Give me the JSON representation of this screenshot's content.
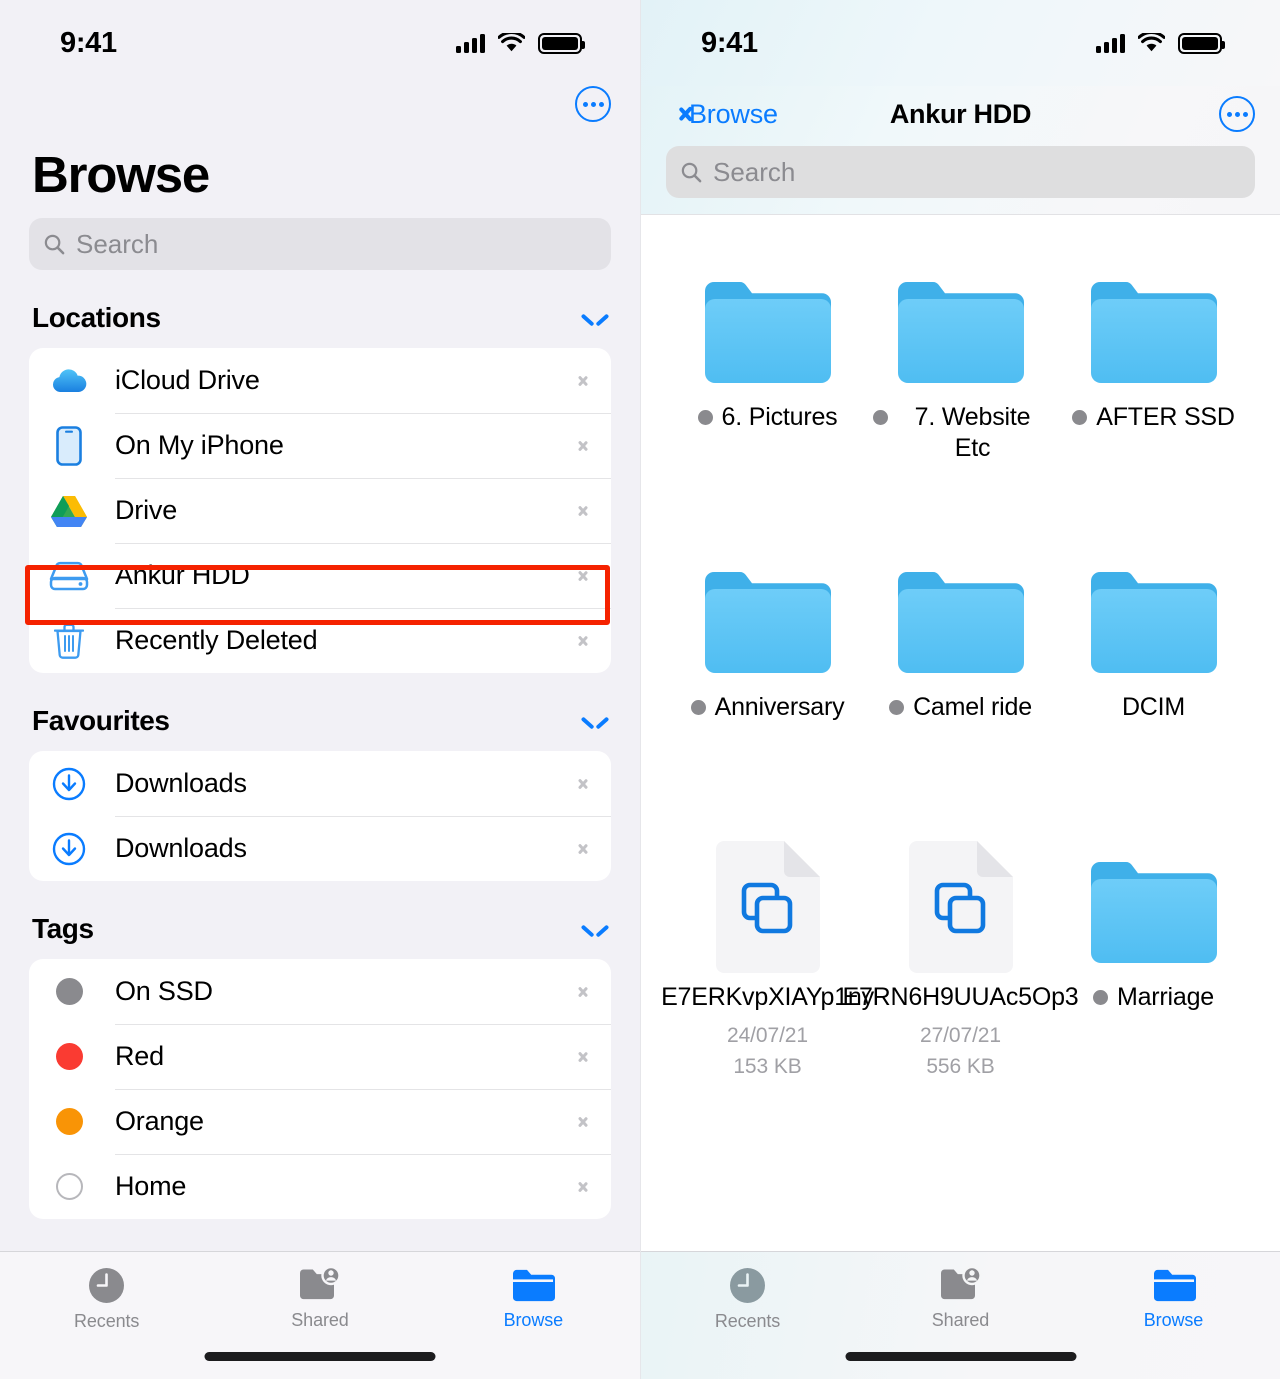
{
  "statusbar": {
    "time": "9:41"
  },
  "left": {
    "title": "Browse",
    "search_placeholder": "Search",
    "more_button": "more-options",
    "sections": [
      {
        "title": "Locations",
        "items": [
          {
            "label": "iCloud Drive",
            "icon": "icloud-drive-icon"
          },
          {
            "label": "On My iPhone",
            "icon": "iphone-icon"
          },
          {
            "label": "Drive",
            "icon": "google-drive-icon"
          },
          {
            "label": "Ankur HDD",
            "icon": "external-drive-icon",
            "highlighted": true
          },
          {
            "label": "Recently Deleted",
            "icon": "trash-icon"
          }
        ]
      },
      {
        "title": "Favourites",
        "items": [
          {
            "label": "Downloads",
            "icon": "download-circle-icon"
          },
          {
            "label": "Downloads",
            "icon": "download-circle-icon"
          }
        ]
      },
      {
        "title": "Tags",
        "items": [
          {
            "label": "On SSD",
            "icon": "tag-dot-icon",
            "color": "#8a8a8e"
          },
          {
            "label": "Red",
            "icon": "tag-dot-icon",
            "color": "#fa3b32"
          },
          {
            "label": "Orange",
            "icon": "tag-dot-icon",
            "color": "#f99406"
          },
          {
            "label": "Home",
            "icon": "tag-dot-icon",
            "color": "#ffffff"
          }
        ]
      }
    ]
  },
  "right": {
    "back_label": "Browse",
    "title": "Ankur HDD",
    "search_placeholder": "Search",
    "more_button": "more-options",
    "items": [
      {
        "name": "6. Pictures",
        "kind": "folder",
        "tagged": true,
        "date": "",
        "size": ""
      },
      {
        "name": "7. Website Etc",
        "kind": "folder",
        "tagged": true,
        "date": "",
        "size": ""
      },
      {
        "name": "AFTER SSD",
        "kind": "folder",
        "tagged": true,
        "date": "",
        "size": ""
      },
      {
        "name": "Anniversary",
        "kind": "folder",
        "tagged": true,
        "date": "",
        "size": ""
      },
      {
        "name": "Camel ride",
        "kind": "folder",
        "tagged": true,
        "date": "",
        "size": ""
      },
      {
        "name": "DCIM",
        "kind": "folder",
        "tagged": false,
        "date": "",
        "size": ""
      },
      {
        "name": "E7ERKvpXIAYp1ny",
        "kind": "document",
        "tagged": false,
        "date": "24/07/21",
        "size": "153 KB"
      },
      {
        "name": "E7RN6H9UUAc5Op3",
        "kind": "document",
        "tagged": false,
        "date": "27/07/21",
        "size": "556 KB"
      },
      {
        "name": "Marriage",
        "kind": "folder",
        "tagged": true,
        "date": "",
        "size": ""
      }
    ]
  },
  "tabbar": {
    "tabs": [
      {
        "label": "Recents",
        "icon": "clock-icon",
        "active": false
      },
      {
        "label": "Shared",
        "icon": "shared-folder-icon",
        "active": false
      },
      {
        "label": "Browse",
        "icon": "folder-icon",
        "active": true
      }
    ]
  },
  "colors": {
    "accent": "#0a7cff",
    "folder": "#5ac4f5",
    "highlight": "#f52200",
    "panel_bg": "#f2f1f6"
  }
}
